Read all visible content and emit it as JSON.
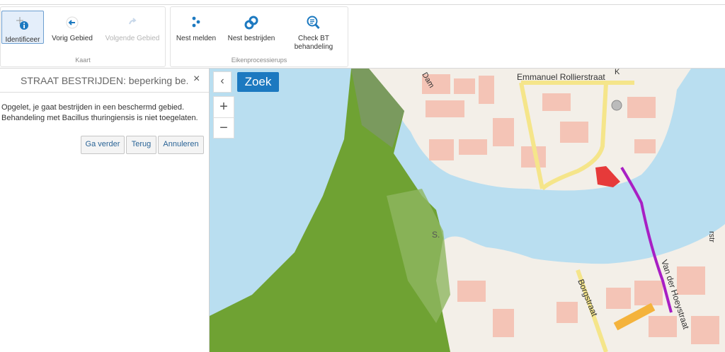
{
  "ribbon": {
    "kaart": {
      "label": "Kaart",
      "buttons": [
        {
          "label": "Identificeer",
          "icon": "info-identify-icon",
          "active": true
        },
        {
          "label": "Vorig Gebied",
          "icon": "back-arrow-icon",
          "active": false
        },
        {
          "label": "Volgende Gebied",
          "icon": "forward-arrow-icon",
          "disabled": true
        }
      ]
    },
    "eiken": {
      "label": "Eikenprocessierups",
      "buttons": [
        {
          "label": "Nest melden",
          "icon": "dots-nest-icon"
        },
        {
          "label": "Nest bestrijden",
          "icon": "link-nest-icon"
        },
        {
          "label_line1": "Check BT",
          "label_line2": "behandeling",
          "icon": "magnifier-check-icon"
        }
      ]
    }
  },
  "panel": {
    "title": "STRAAT BESTRIJDEN: beperking be...",
    "close": "×",
    "message_line1": "Opgelet, je gaat bestrijden in een beschermd gebied.",
    "message_line2": "Behandeling met Bacillus thuringiensis is niet toegelaten.",
    "buttons": {
      "continue": "Ga verder",
      "back": "Terug",
      "cancel": "Annuleren"
    }
  },
  "map": {
    "collapse": "‹",
    "search_label": "Zoek",
    "zoom_in": "+",
    "zoom_out": "−",
    "streets": {
      "emmanuel": "Emmanuel Rollierstraat",
      "dam": "Dam",
      "borgstraat": "Borgstraat",
      "vanderhoeystraat": "Van der Hoeystraat",
      "k": "K",
      "s": "S.",
      "rstr": "rstr"
    },
    "colors": {
      "water": "#b9def0",
      "protected_area": "#6fa233",
      "route": "#a81fc4",
      "search_button": "#1c79c0"
    }
  }
}
